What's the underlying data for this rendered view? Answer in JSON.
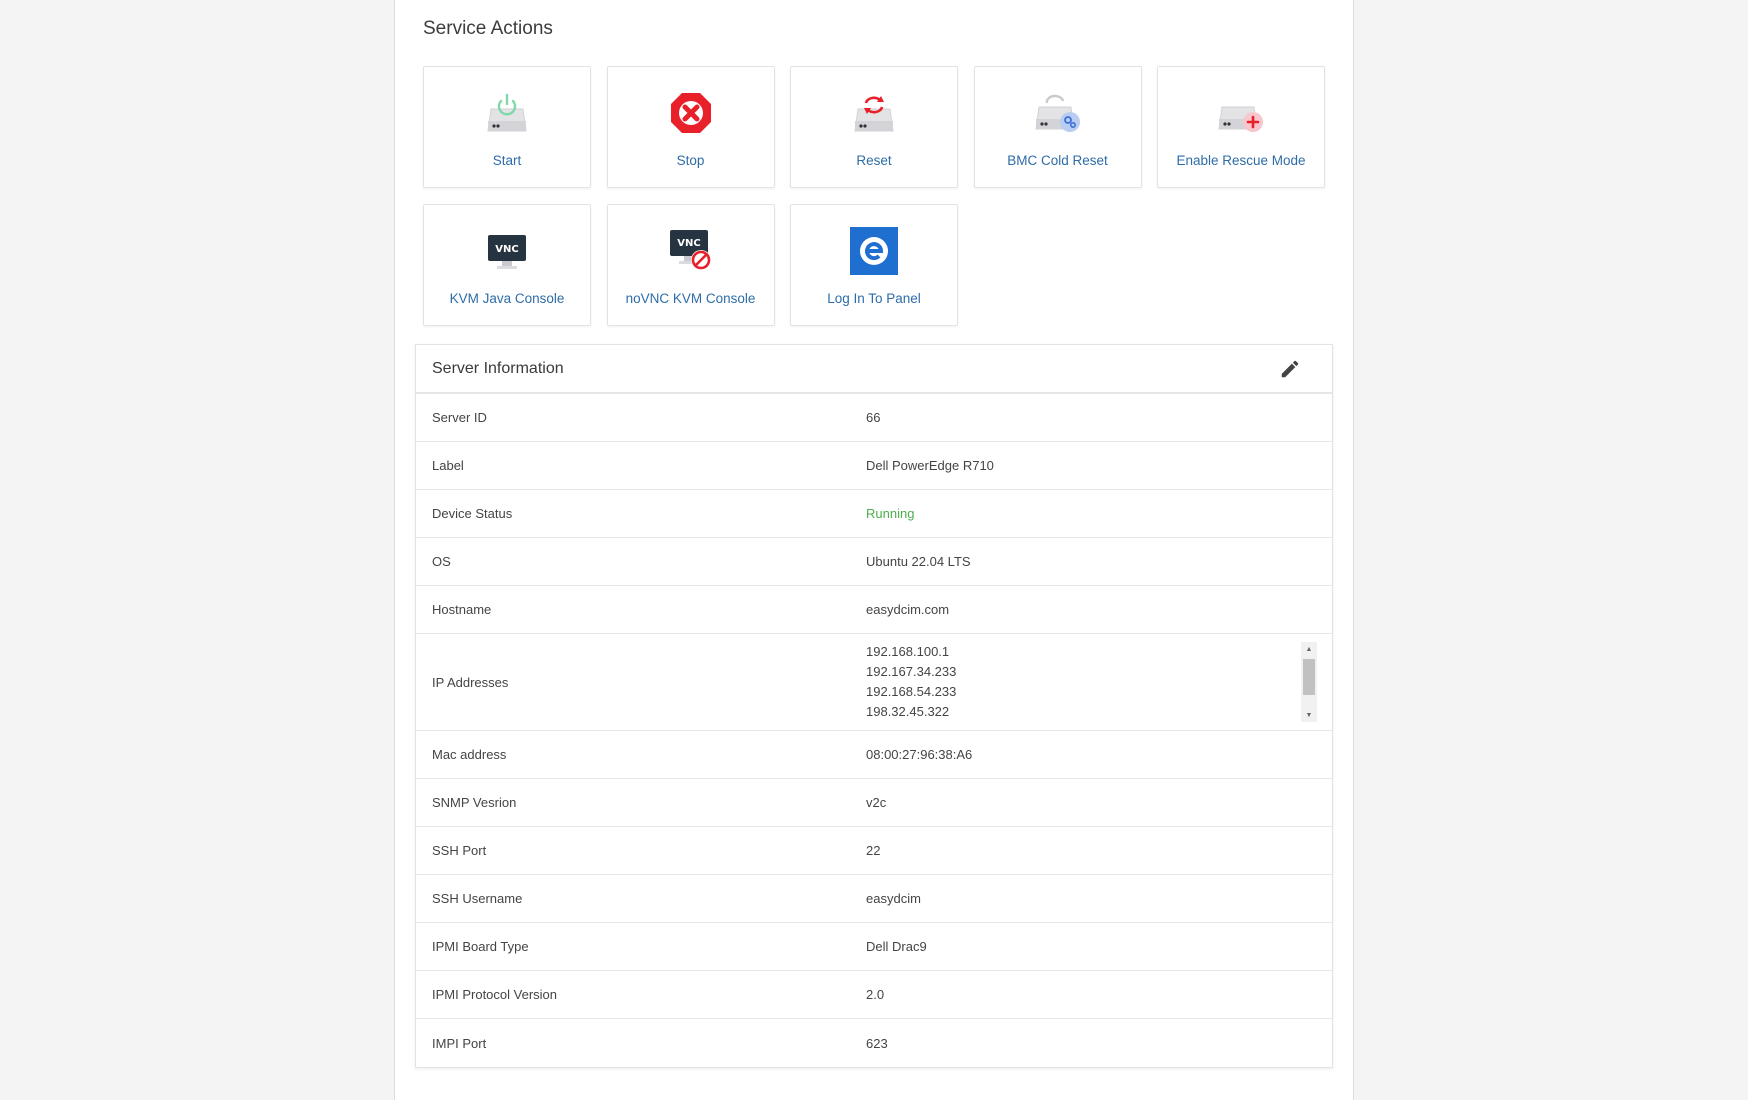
{
  "service_actions": {
    "title": "Service Actions",
    "buttons": [
      {
        "label": "Start",
        "icon": "server-power-icon"
      },
      {
        "label": "Stop",
        "icon": "stop-octagon-icon"
      },
      {
        "label": "Reset",
        "icon": "server-reset-icon"
      },
      {
        "label": "BMC Cold Reset",
        "icon": "server-bmc-reset-icon"
      },
      {
        "label": "Enable Rescue Mode",
        "icon": "server-rescue-icon"
      },
      {
        "label": "KVM Java Console",
        "icon": "vnc-monitor-icon"
      },
      {
        "label": "noVNC KVM Console",
        "icon": "vnc-disabled-icon"
      },
      {
        "label": "Log In To Panel",
        "icon": "panel-logo-icon"
      }
    ],
    "vnc_text": "VNC"
  },
  "server_info": {
    "title": "Server Information",
    "edit_icon": "pencil-icon",
    "rows": [
      {
        "label": "Server ID",
        "value": "66"
      },
      {
        "label": "Label",
        "value": "Dell PowerEdge R710"
      },
      {
        "label": "Device Status",
        "value": "Running"
      },
      {
        "label": "OS",
        "value": "Ubuntu 22.04 LTS"
      },
      {
        "label": "Hostname",
        "value": "easydcim.com"
      },
      {
        "label": "IP Addresses",
        "values": [
          "192.168.100.1",
          "192.167.34.233",
          "192.168.54.233",
          "198.32.45.322"
        ]
      },
      {
        "label": "Mac address",
        "value": "08:00:27:96:38:A6"
      },
      {
        "label": "SNMP Vesrion",
        "value": "v2c"
      },
      {
        "label": "SSH Port",
        "value": "22"
      },
      {
        "label": "SSH Username",
        "value": "easydcim"
      },
      {
        "label": "IPMI Board Type",
        "value": "Dell Drac9"
      },
      {
        "label": "IPMI Protocol Version",
        "value": "2.0"
      },
      {
        "label": "IMPI Port",
        "value": "623"
      }
    ]
  },
  "colors": {
    "link": "#2e6ca8",
    "status_running": "#4cae4c",
    "stop_red": "#e8202a",
    "panel_blue": "#1f6fd1"
  }
}
